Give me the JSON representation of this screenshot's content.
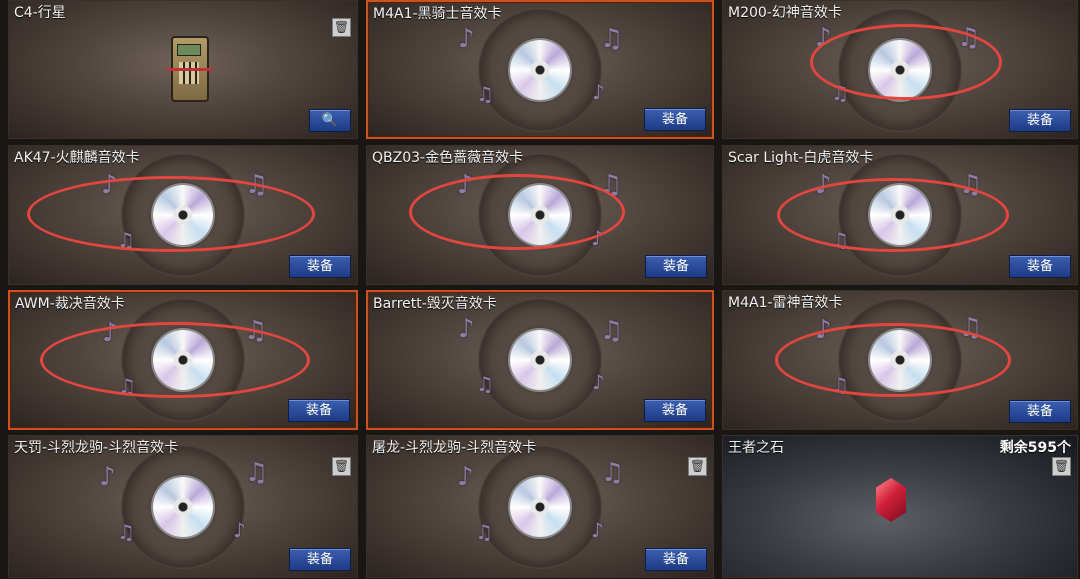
{
  "colors": {
    "equip_button": "#2a4a9a",
    "selected_border": "#c9521e",
    "highlight_ring": "#e2463f"
  },
  "actions": {
    "equip_label": "装备"
  },
  "items": [
    {
      "title": "C4-行星",
      "kind": "c4",
      "actions": [
        "trash",
        "search"
      ]
    },
    {
      "title": "M4A1-黑骑士音效卡",
      "kind": "disc",
      "selected": true,
      "actions": [
        "equip"
      ]
    },
    {
      "title": "M200-幻神音效卡",
      "kind": "disc",
      "circled": true,
      "actions": [
        "equip"
      ]
    },
    {
      "title": "AK47-火麒麟音效卡",
      "kind": "disc",
      "circled": true,
      "actions": [
        "equip"
      ]
    },
    {
      "title": "QBZ03-金色蔷薇音效卡",
      "kind": "disc",
      "circled": true,
      "actions": [
        "equip"
      ]
    },
    {
      "title": "Scar Light-白虎音效卡",
      "kind": "disc",
      "circled": true,
      "actions": [
        "equip"
      ]
    },
    {
      "title": "AWM-裁决音效卡",
      "kind": "disc",
      "selected": true,
      "circled": true,
      "actions": [
        "equip"
      ]
    },
    {
      "title": "Barrett-毁灭音效卡",
      "kind": "disc",
      "selected": true,
      "actions": [
        "equip"
      ]
    },
    {
      "title": "M4A1-雷神音效卡",
      "kind": "disc",
      "circled": true,
      "actions": [
        "equip"
      ]
    },
    {
      "title": "天罚-斗烈龙驹-斗烈音效卡",
      "kind": "disc",
      "actions": [
        "trash",
        "equip"
      ]
    },
    {
      "title": "屠龙-斗烈龙驹-斗烈音效卡",
      "kind": "disc",
      "actions": [
        "trash",
        "equip"
      ]
    },
    {
      "title": "王者之石",
      "kind": "gem",
      "count": "剩余595个",
      "actions": [
        "trash"
      ]
    }
  ]
}
